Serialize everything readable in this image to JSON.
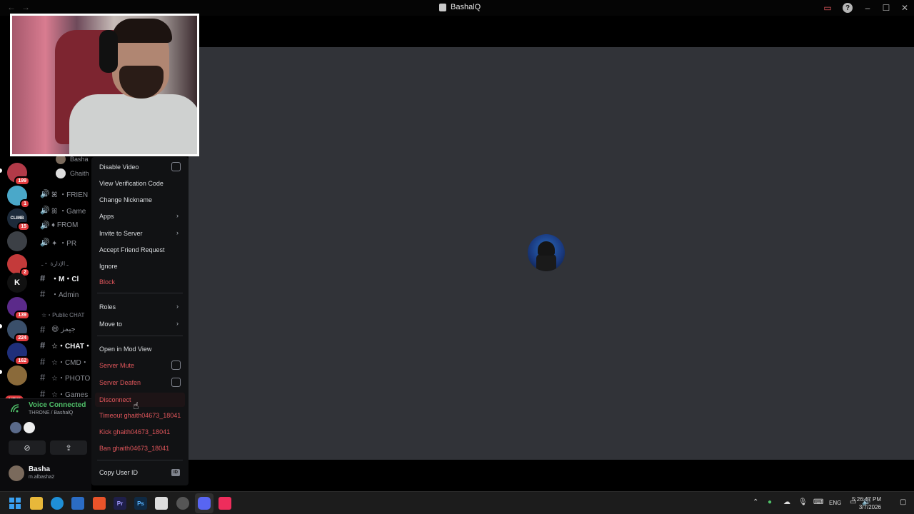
{
  "window": {
    "title": "BashalQ",
    "nav_back": "←",
    "nav_fwd": "→",
    "help_glyph": "?",
    "minimize_glyph": "–",
    "maximize_glyph": "☐",
    "close_glyph": "✕"
  },
  "rail": {
    "servers": [
      {
        "badge": "199"
      },
      {
        "badge": "1"
      },
      {
        "badge": "15",
        "label": "CLIMB"
      },
      {
        "badge": ""
      },
      {
        "badge": "2"
      },
      {
        "label": "K",
        "badge": ""
      },
      {
        "badge": "139"
      },
      {
        "badge": "224"
      },
      {
        "badge": "162"
      },
      {
        "badge": ""
      }
    ],
    "new_badge": "NEW"
  },
  "channels": {
    "voice_users": [
      {
        "name": "Basha"
      },
      {
        "name": "Ghaith"
      }
    ],
    "items": [
      {
        "label": "ꕤ ・FRIEN",
        "type": "voice"
      },
      {
        "label": "ꕤ ・Game",
        "type": "voice"
      },
      {
        "label": "♦ FROM",
        "type": "voice"
      },
      {
        "label": "✦ ・PR",
        "type": "voice"
      }
    ],
    "cat_admin": "ـ الإدارة ・ـ",
    "admin_items": [
      {
        "label": "・M・Cl",
        "type": "text",
        "bold": true
      },
      {
        "label": "・Admin",
        "type": "text"
      }
    ],
    "cat_public": "☆・Public CHAT",
    "public_items": [
      {
        "label": "😄 جيمز",
        "type": "text"
      },
      {
        "label": "☆・CHAT・",
        "type": "text",
        "bold": true
      },
      {
        "label": "☆・CMD・",
        "type": "text"
      },
      {
        "label": "☆・PHOTO",
        "type": "text"
      },
      {
        "label": "☆・Games",
        "type": "text"
      }
    ]
  },
  "voice": {
    "title": "Voice Connected",
    "subtitle": "THRONE / BashalQ",
    "signal_icon": "signal-icon"
  },
  "user": {
    "name": "Basha",
    "tag": "m.albasha2"
  },
  "context_menu": {
    "disable_video": "Disable Video",
    "view_verification": "View Verification Code",
    "change_nickname": "Change Nickname",
    "apps": "Apps",
    "invite": "Invite to Server",
    "accept_friend": "Accept Friend Request",
    "ignore": "Ignore",
    "block": "Block",
    "roles": "Roles",
    "move_to": "Move to",
    "open_mod_view": "Open in Mod View",
    "server_mute": "Server Mute",
    "server_deafen": "Server Deafen",
    "disconnect": "Disconnect",
    "timeout": "Timeout ghaith04673_18041",
    "kick": "Kick ghaith04673_18041",
    "ban": "Ban ghaith04673_18041",
    "copy_id": "Copy User ID",
    "id_badge": "ID",
    "chevron": "›"
  },
  "taskbar": {
    "lang": "ENG",
    "time": "5:26:47 PM",
    "date": "3/7/2026",
    "apps": [
      "windows-start-icon",
      "file-explorer-icon",
      "edge-icon",
      "store-icon",
      "brave-icon",
      "premiere-icon",
      "photoshop-icon",
      "snipping-icon",
      "chrome-icon",
      "discord-icon",
      "tiktok-icon"
    ],
    "premiere_label": "Pr",
    "photoshop_label": "Ps"
  },
  "colors": {
    "accent_green": "#4fbf68",
    "danger_red": "#e0565b",
    "stage_bg": "#313338",
    "menu_bg": "#111214"
  }
}
